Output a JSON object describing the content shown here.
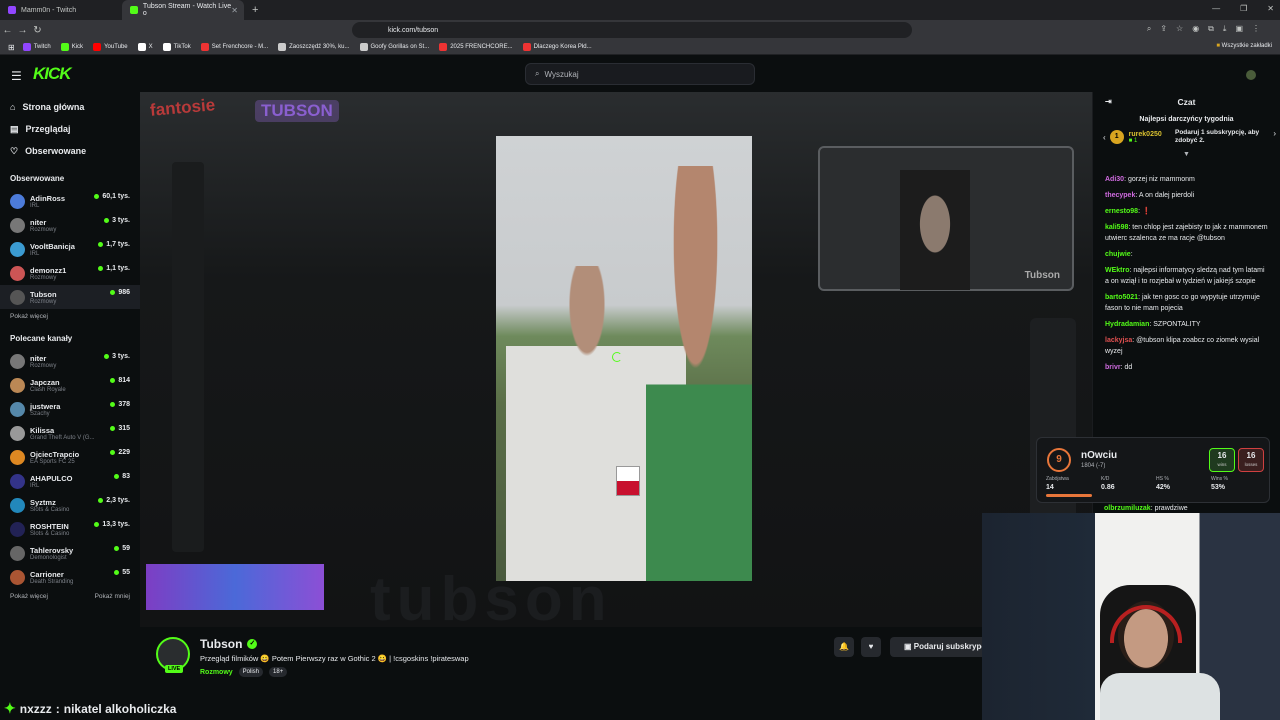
{
  "browser": {
    "tabs": [
      {
        "title": "Mamm0n - Twitch",
        "color": "#9146ff"
      },
      {
        "title": "Tubson Stream - Watch Live o",
        "color": "#53fc18"
      }
    ],
    "url": "kick.com/tubson",
    "bookmarks": [
      {
        "label": "Twitch",
        "color": "#9146ff"
      },
      {
        "label": "Kick",
        "color": "#53fc18"
      },
      {
        "label": "YouTube",
        "color": "#ff0000"
      },
      {
        "label": "X",
        "color": "#ffffff"
      },
      {
        "label": "TikTok",
        "color": "#ffffff"
      },
      {
        "label": "Set Frenchcore - M...",
        "color": "#e33"
      },
      {
        "label": "Zaoszczędź 30%, ku...",
        "color": "#ccc"
      },
      {
        "label": "Goofy Gorillas on St...",
        "color": "#ccc"
      },
      {
        "label": "2025 FRENCHCORE...",
        "color": "#e33"
      },
      {
        "label": "Dlaczego Korea Płd...",
        "color": "#e33"
      }
    ],
    "all_bookmarks": "Wszystkie zakładki"
  },
  "kick": {
    "logo": "KICK",
    "search_placeholder": "Wyszukaj",
    "nav": [
      {
        "label": "Strona główna",
        "icon": "home-icon"
      },
      {
        "label": "Przeglądaj",
        "icon": "browse-icon"
      },
      {
        "label": "Obserwowane",
        "icon": "heart-icon"
      }
    ],
    "followed_title": "Obserwowane",
    "followed": [
      {
        "name": "AdinRoss",
        "cat": "IRL",
        "viewers": "60,1 tys.",
        "color": "#4c7bd9"
      },
      {
        "name": "niter",
        "cat": "Rozmowy",
        "viewers": "3 tys.",
        "color": "#777"
      },
      {
        "name": "VooltBanicja",
        "cat": "IRL",
        "viewers": "1,7 tys.",
        "color": "#3b9bd1"
      },
      {
        "name": "demonzz1",
        "cat": "Rozmowy",
        "viewers": "1,1 tys.",
        "color": "#c55"
      },
      {
        "name": "Tubson",
        "cat": "Rozmowy",
        "viewers": "986",
        "color": "#555"
      }
    ],
    "show_more": "Pokaż więcej",
    "recommended_title": "Polecane kanały",
    "recommended": [
      {
        "name": "niter",
        "cat": "Rozmowy",
        "viewers": "3 tys.",
        "color": "#777"
      },
      {
        "name": "Japczan",
        "cat": "Clash Royale",
        "viewers": "814",
        "color": "#b85"
      },
      {
        "name": "justwera",
        "cat": "Szachy",
        "viewers": "378",
        "color": "#58a"
      },
      {
        "name": "Kilissa",
        "cat": "Grand Theft Auto V (G...",
        "viewers": "315",
        "color": "#999"
      },
      {
        "name": "OjciecTrapcio",
        "cat": "EA Sports FC 25",
        "viewers": "229",
        "color": "#d82"
      },
      {
        "name": "AHAPULCO",
        "cat": "IRL",
        "viewers": "83",
        "color": "#338"
      },
      {
        "name": "Syztmz",
        "cat": "Slots & Casino",
        "viewers": "2,3 tys.",
        "color": "#28b"
      },
      {
        "name": "ROSHTEIN",
        "cat": "Slots & Casino",
        "viewers": "13,3 tys.",
        "color": "#225"
      },
      {
        "name": "Tahlerovsky",
        "cat": "Demonologist",
        "viewers": "59",
        "color": "#666"
      },
      {
        "name": "Carrioner",
        "cat": "Death Stranding",
        "viewers": "55",
        "color": "#a53"
      }
    ],
    "show_less": "Pokaż mniej"
  },
  "player": {
    "overlay_left": "fantosie",
    "overlay_right": "TUBSON",
    "webcam_tag": "Tubson",
    "ghost": "tubson"
  },
  "stream": {
    "name": "Tubson",
    "live": "LIVE",
    "title": "Przegląd filmików 😀 Potem Pierwszy raz w Gothic 2 😀 | !csgoskins !pirateswap",
    "category": "Rozmowy",
    "tags": [
      "Polish",
      "18+"
    ],
    "sub_button": "Podaruj subskrypcję"
  },
  "chat": {
    "title": "Czat",
    "gifters_title": "Najlepsi darczyńcy tygodnia",
    "gifter": {
      "rank": "1",
      "name": "rurek0250",
      "count": "1"
    },
    "gift_cta": "Podaruj 1 subskrypcję, aby zdobyć 2.",
    "messages": [
      {
        "user": "Adi30",
        "text": "gorzej niz mammonm",
        "color": "#d06be0"
      },
      {
        "user": "thecypek",
        "text": "A on dalej pierdoli",
        "color": "#d06be0"
      },
      {
        "user": "ernesto98",
        "text": "❗",
        "color": "#53fc18"
      },
      {
        "user": "kali598",
        "text": "ten chlop jest zajebisty to jak z mammonem utwierc szalenca ze ma racje @tubson",
        "color": "#53fc18"
      },
      {
        "user": "chujwie",
        "text": "",
        "color": "#53fc18"
      },
      {
        "user": "WEktro",
        "text": "najlepsi informatycy sledzą nad tym latami a on wziął i to rozjebał w tydzień w jakiejś szopie",
        "color": "#53fc18"
      },
      {
        "user": "barto5021",
        "text": "jak ten gosc co go wypytuje utrzymuje fason to nie mam pojecia",
        "color": "#53fc18"
      },
      {
        "user": "Hydradamian",
        "text": "SZPONTALITY",
        "color": "#53fc18"
      },
      {
        "user": "lackyjsa",
        "text": "@tubson klipa zoabcz co ziomek wysial wyzej",
        "color": "#e05050"
      },
      {
        "user": "brivr",
        "text": "dd",
        "color": "#d06be0"
      }
    ],
    "last_msg": {
      "user": "olbrzumiluzak",
      "text": "prawdziwe",
      "color": "#53fc18"
    }
  },
  "stats": {
    "rank": "9",
    "name": "nOwciu",
    "elo": "1804 (-7)",
    "wins": "16",
    "wins_label": "wins",
    "losses": "16",
    "losses_label": "losses",
    "cols": [
      {
        "label": "Zabójstwa",
        "value": "14"
      },
      {
        "label": "K/D",
        "value": "0.86"
      },
      {
        "label": "HS %",
        "value": "42%"
      },
      {
        "label": "Wins %",
        "value": "53%"
      }
    ]
  },
  "bottom_message": {
    "user": "nxzzz",
    "text": "nikatel alkoholiczka"
  }
}
